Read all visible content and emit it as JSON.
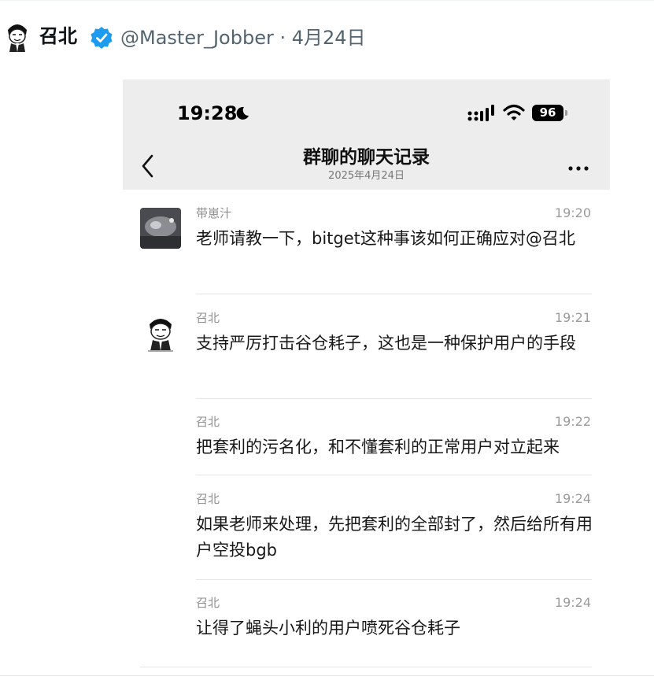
{
  "tweet": {
    "author_name": "召北",
    "handle_line": "@Master_Jobber · 4月24日"
  },
  "phone": {
    "status_time": "19:28",
    "battery": "96",
    "chat_title": "群聊的聊天记录",
    "chat_date": "2025年4月24日"
  },
  "colors": {
    "verified_badge": "#1d9bf0",
    "status_bar_bg": "#ededed"
  },
  "messages": [
    {
      "sender": "带崽汁",
      "time": "19:20",
      "text": "老师请教一下，bitget这种事该如何正确应对@召北",
      "avatar": "photo-avatar"
    },
    {
      "sender": "召北",
      "time": "19:21",
      "text": "支持严厉打击谷仓耗子，这也是一种保护用户的手段",
      "avatar": "cartoon-avatar"
    },
    {
      "sender": "召北",
      "time": "19:22",
      "text": "把套利的污名化，和不懂套利的正常用户对立起来",
      "avatar": ""
    },
    {
      "sender": "召北",
      "time": "19:24",
      "text": "如果老师来处理，先把套利的全部封了，然后给所有用户空投bgb",
      "avatar": ""
    },
    {
      "sender": "召北",
      "time": "19:24",
      "text": "让得了蝇头小利的用户喷死谷仓耗子",
      "avatar": ""
    }
  ]
}
